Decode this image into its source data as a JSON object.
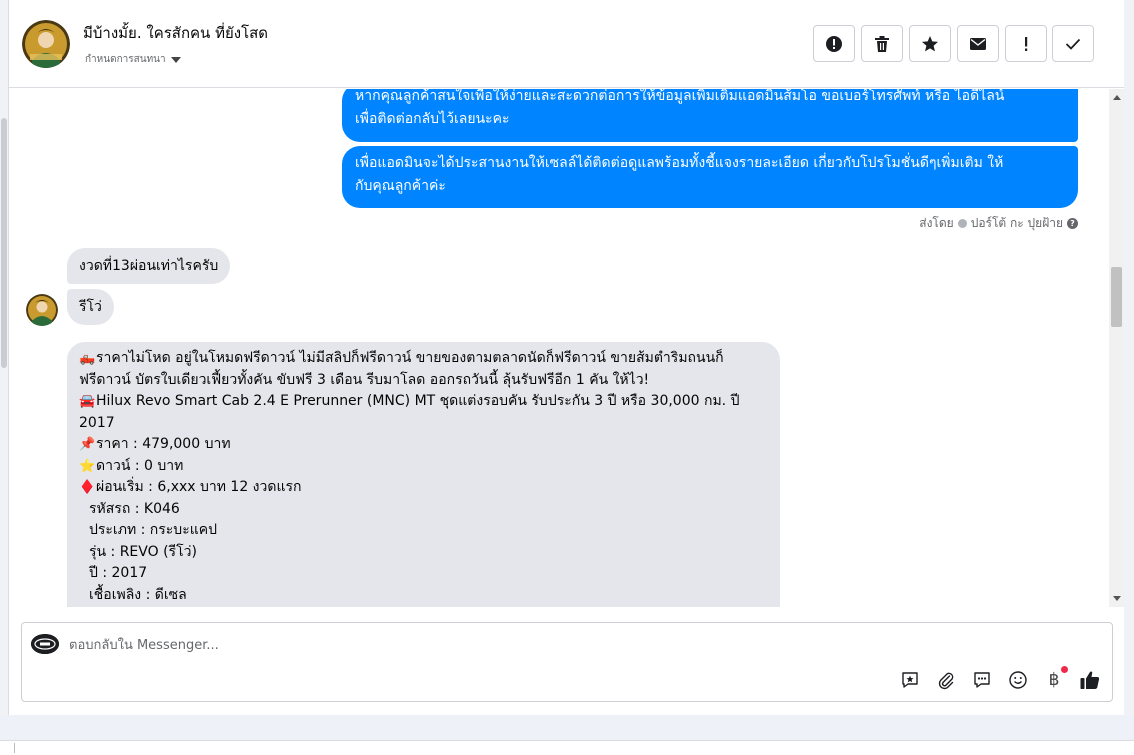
{
  "header": {
    "title": "มีบ้างมั้ย. ใครสักคน ที่ยังโสด",
    "assign_label": "กำหนดการสนทนา",
    "toolbar": [
      {
        "icon": "alert-circle-icon"
      },
      {
        "icon": "trash-icon"
      },
      {
        "icon": "star-icon"
      },
      {
        "icon": "envelope-icon"
      },
      {
        "icon": "exclamation-icon"
      },
      {
        "icon": "check-icon"
      }
    ]
  },
  "thread": {
    "outgoing": [
      {
        "lines": [
          "หากคุณลูกค้าสนใจเพื่อให้ง่ายและสะดวกต่อการให้ข้อมูลเพิ่มเติมแอดมินส้มโอ ขอเบอร์โทรศัพท์ หรือ ไอดีไลน์",
          "เพื่อติดต่อกลับไว้เลยนะคะ"
        ]
      },
      {
        "lines": [
          "เพื่อแอดมินจะได้ประสานงานให้เซลล์ได้ติดต่อดูแลพร้อมทั้งชี้แจงรายละเอียด เกี่ยวกับโปรโมชั่นดีๆเพิ่มเติม ให้",
          "กับคุณลูกค้าค่ะ"
        ]
      }
    ],
    "sent_by": {
      "prefix": "ส่งโดย",
      "name": "ปอร์โต้ กะ ปุยฝ้าย"
    },
    "incoming": [
      {
        "text": "งวดที่13ผ่อนเท่าไรครับ"
      },
      {
        "text": "รีโว่"
      }
    ],
    "listing": {
      "lines": [
        {
          "emoji": "🛻",
          "text": "ราคาไม่โหด อยู่ในโหมดฟรีดาวน์ ไม่มีสลิปก็ฟรีดาวน์ ขายของตามตลาดนัดก็ฟรีดาวน์ ขายส้มตำริมถนนก็"
        },
        {
          "emoji": "",
          "text": "ฟรีดาวน์ บัตรใบเดียวเฟี้ยวทั้งคัน ขับฟรี 3 เดือน รีบมาโลด ออกรถวันนี้ ลุ้นรับฟรีอีก 1 คัน ให้ไว!"
        },
        {
          "emoji": "🚘",
          "text": "Hilux Revo Smart Cab 2.4 E Prerunner (MNC) MT ชุดแต่งรอบคัน รับประกัน 3 ปี หรือ 30,000 กม. ปี"
        },
        {
          "emoji": "",
          "text": "2017"
        },
        {
          "emoji": "📌",
          "text": "ราคา : 479,000 บาท"
        },
        {
          "emoji": "⭐",
          "text": "ดาวน์ : 0 บาท"
        },
        {
          "emoji": "♦️",
          "text": "ผ่อนเริ่ม : 6,xxx บาท 12 งวดแรก"
        },
        {
          "emoji": "",
          "text": "รหัสรถ : K046"
        },
        {
          "emoji": "",
          "text": "ประเภท : กระบะแคป"
        },
        {
          "emoji": "",
          "text": "รุ่น : REVO (รีโว่)"
        },
        {
          "emoji": "",
          "text": "ปี : 2017"
        },
        {
          "emoji": "",
          "text": "เชื้อเพลิง : ดีเซล"
        }
      ]
    }
  },
  "composer": {
    "placeholder": "ตอบกลับใน Messenger...",
    "tools": [
      "saved-reply-icon",
      "paperclip-icon",
      "chat-bubble-icon",
      "emoji-icon",
      "baht-icon",
      "thumbs-up-icon"
    ],
    "baht_symbol": "฿"
  },
  "colors": {
    "outgoing_bubble": "#0084ff",
    "incoming_bubble": "#e4e6eb",
    "notification_dot": "#f02849"
  }
}
